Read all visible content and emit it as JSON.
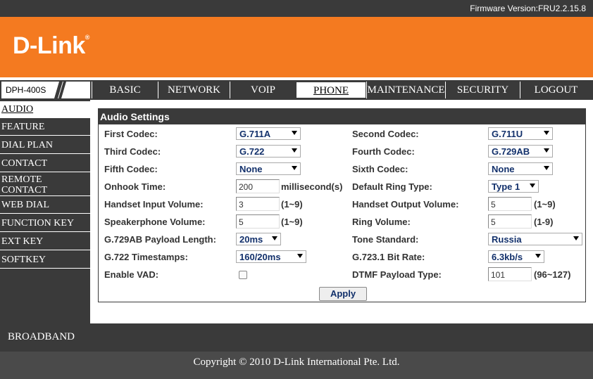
{
  "firmware": "Firmware Version:FRU2.2.15.8",
  "brand": "D-Link",
  "brand_mark": "®",
  "model": "DPH-400S",
  "tabs": [
    "BASIC",
    "NETWORK",
    "VOIP",
    "PHONE",
    "MAINTENANCE",
    "SECURITY",
    "LOGOUT"
  ],
  "active_tab": "PHONE",
  "sidebar": {
    "items": [
      "AUDIO",
      "FEATURE",
      "DIAL PLAN",
      "CONTACT",
      "REMOTE CONTACT",
      "WEB DIAL",
      "FUNCTION KEY",
      "EXT KEY",
      "SOFTKEY"
    ],
    "remote_line1": "REMOTE",
    "remote_line2": "CONTACT",
    "active": "AUDIO"
  },
  "panel_title": "Audio Settings",
  "fields": {
    "first_codec": {
      "label": "First Codec:",
      "value": "G.711A"
    },
    "second_codec": {
      "label": "Second Codec:",
      "value": "G.711U"
    },
    "third_codec": {
      "label": "Third Codec:",
      "value": "G.722"
    },
    "fourth_codec": {
      "label": "Fourth Codec:",
      "value": "G.729AB"
    },
    "fifth_codec": {
      "label": "Fifth Codec:",
      "value": "None"
    },
    "sixth_codec": {
      "label": "Sixth Codec:",
      "value": "None"
    },
    "onhook_time": {
      "label": "Onhook Time:",
      "value": "200",
      "suffix": "millisecond(s)"
    },
    "default_ring_type": {
      "label": "Default Ring Type:",
      "value": "Type 1"
    },
    "handset_input_volume": {
      "label": "Handset Input Volume:",
      "value": "3",
      "suffix": "(1~9)"
    },
    "handset_output_volume": {
      "label": "Handset Output Volume:",
      "value": "5",
      "suffix": "(1~9)"
    },
    "speakerphone_volume": {
      "label": "Speakerphone Volume:",
      "value": "5",
      "suffix": "(1~9)"
    },
    "ring_volume": {
      "label": "Ring Volume:",
      "value": "5",
      "suffix": "(1-9)"
    },
    "g729ab_payload_length": {
      "label": "G.729AB Payload Length:",
      "value": "20ms"
    },
    "tone_standard": {
      "label": "Tone Standard:",
      "value": "Russia"
    },
    "g722_timestamps": {
      "label": "G.722 Timestamps:",
      "value": "160/20ms"
    },
    "g7231_bit_rate": {
      "label": "G.723.1 Bit Rate:",
      "value": "6.3kb/s"
    },
    "enable_vad": {
      "label": "Enable VAD:",
      "checked": false
    },
    "dtmf_payload_type": {
      "label": "DTMF Payload Type:",
      "value": "101",
      "suffix": "(96~127)"
    }
  },
  "apply_label": "Apply",
  "broadband": "BROADBAND",
  "copyright": "Copyright © 2010 D-Link International Pte. Ltd."
}
